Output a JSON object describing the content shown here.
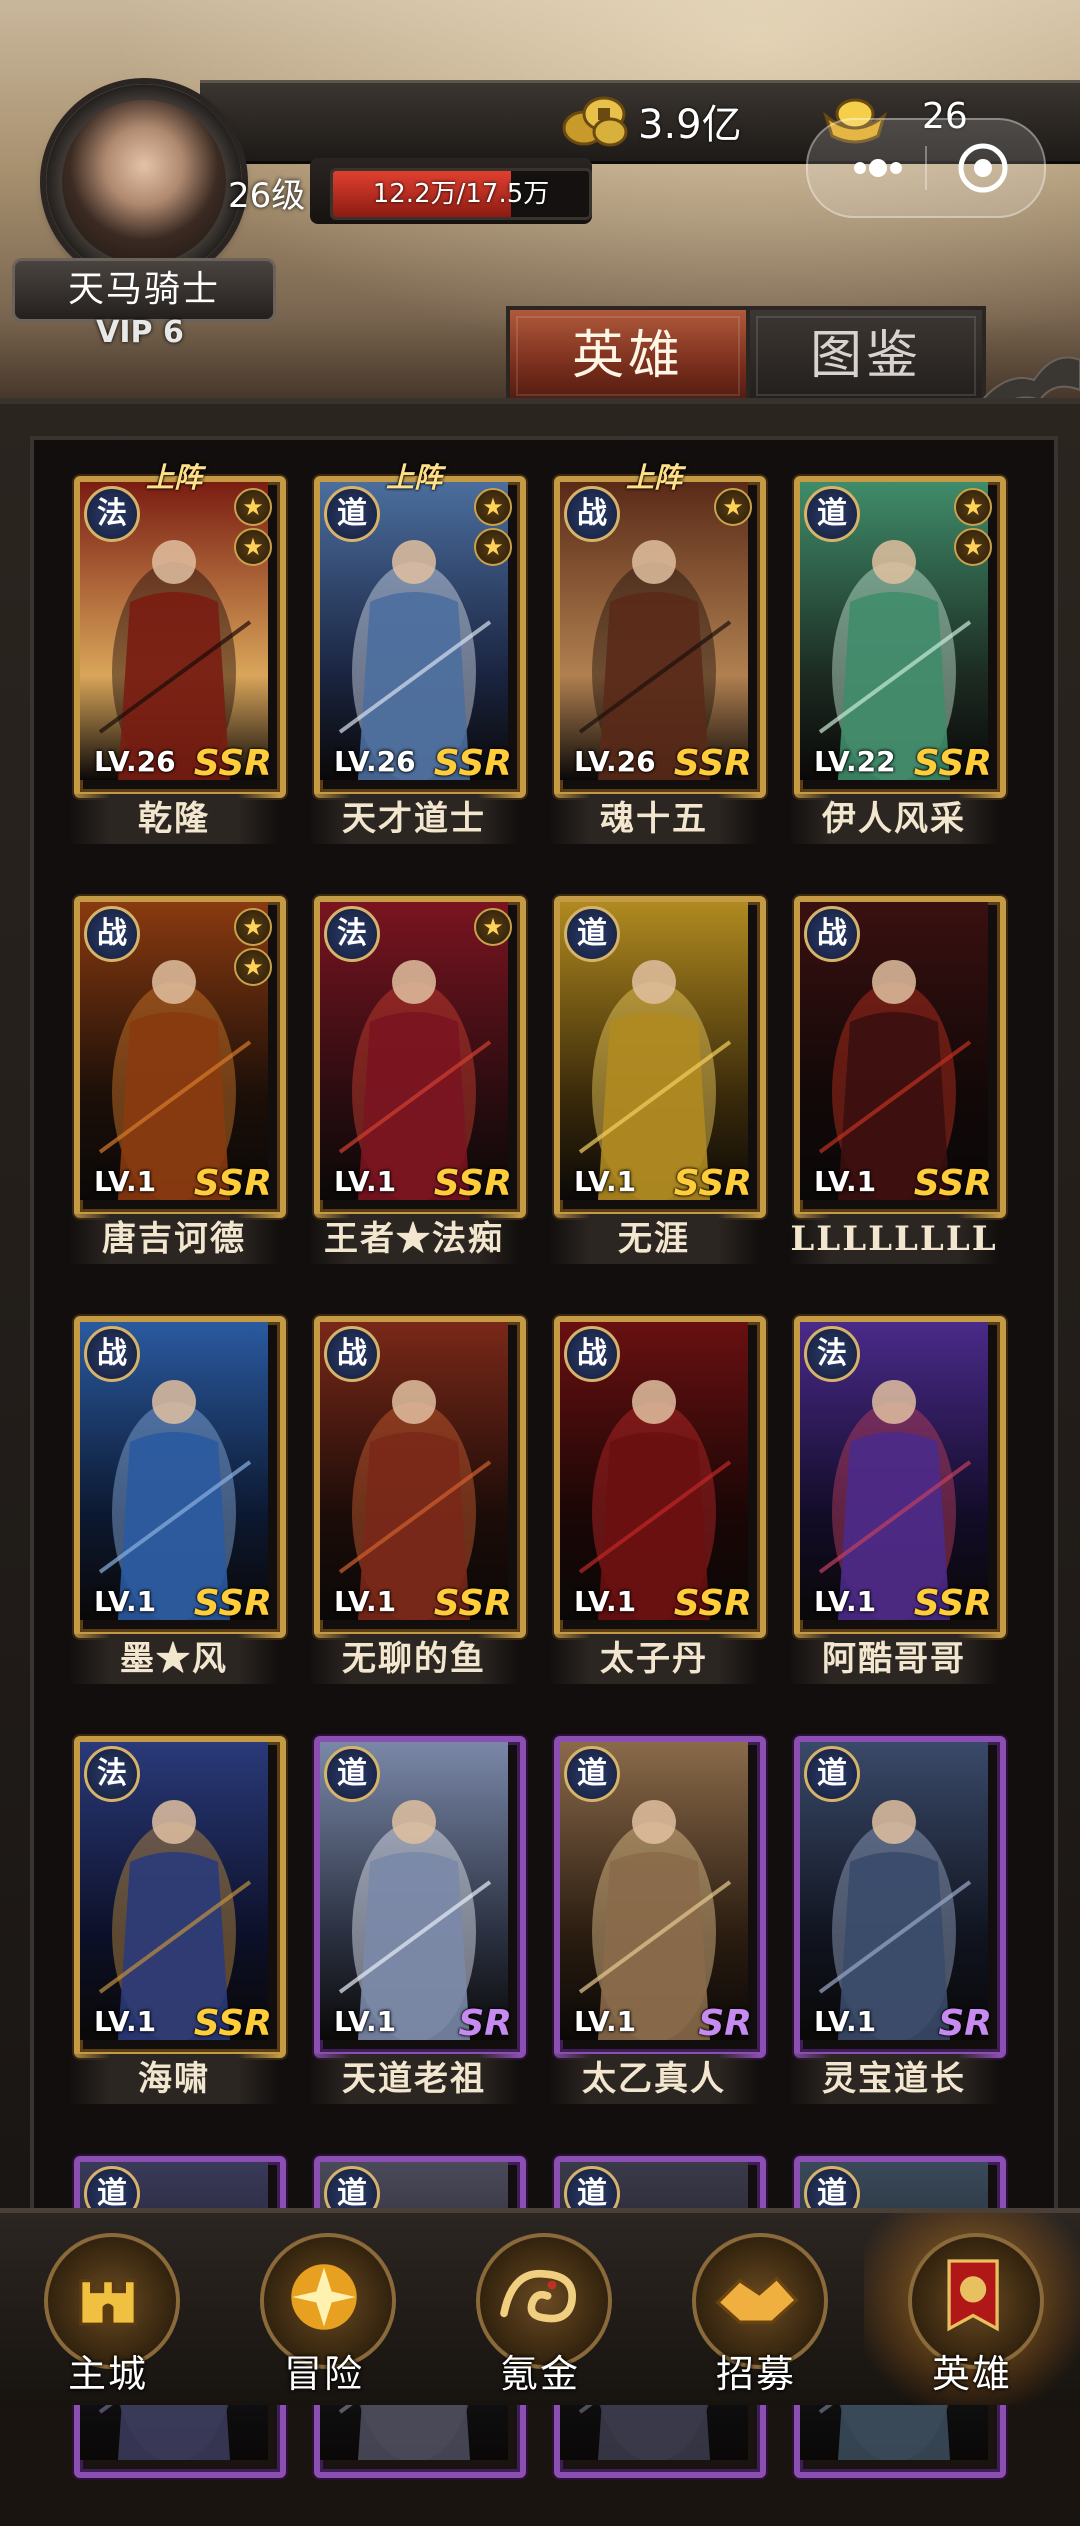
{
  "header": {
    "player_name": "天马骑士",
    "vip": "VIP 6",
    "level": "26级",
    "exp_text": "12.2万/17.5万",
    "exp_fraction": 0.697,
    "gold": "3.9亿",
    "ingots": "26"
  },
  "tabs": {
    "heroes": "英雄",
    "codex": "图鉴"
  },
  "deploy_label": "上阵",
  "heroes": [
    {
      "name": "乾隆",
      "class": "法",
      "level": "LV.26",
      "rarity": "SSR",
      "deployed": true,
      "stars": 2
    },
    {
      "name": "天才道士",
      "class": "道",
      "level": "LV.26",
      "rarity": "SSR",
      "deployed": true,
      "stars": 2
    },
    {
      "name": "魂十五",
      "class": "战",
      "level": "LV.26",
      "rarity": "SSR",
      "deployed": true,
      "stars": 1
    },
    {
      "name": "伊人风采",
      "class": "道",
      "level": "LV.22",
      "rarity": "SSR",
      "deployed": false,
      "stars": 2
    },
    {
      "name": "唐吉诃德",
      "class": "战",
      "level": "LV.1",
      "rarity": "SSR",
      "deployed": false,
      "stars": 2
    },
    {
      "name": "王者★法痴",
      "class": "法",
      "level": "LV.1",
      "rarity": "SSR",
      "deployed": false,
      "stars": 1
    },
    {
      "name": "无涯",
      "class": "道",
      "level": "LV.1",
      "rarity": "SSR",
      "deployed": false,
      "stars": 0
    },
    {
      "name": "LLLLLLLL",
      "class": "战",
      "level": "LV.1",
      "rarity": "SSR",
      "deployed": false,
      "stars": 0
    },
    {
      "name": "墨★风",
      "class": "战",
      "level": "LV.1",
      "rarity": "SSR",
      "deployed": false,
      "stars": 0
    },
    {
      "name": "无聊的鱼",
      "class": "战",
      "level": "LV.1",
      "rarity": "SSR",
      "deployed": false,
      "stars": 0
    },
    {
      "name": "太子丹",
      "class": "战",
      "level": "LV.1",
      "rarity": "SSR",
      "deployed": false,
      "stars": 0
    },
    {
      "name": "阿酷哥哥",
      "class": "法",
      "level": "LV.1",
      "rarity": "SSR",
      "deployed": false,
      "stars": 0
    },
    {
      "name": "海啸",
      "class": "法",
      "level": "LV.1",
      "rarity": "SSR",
      "deployed": false,
      "stars": 0
    },
    {
      "name": "天道老祖",
      "class": "道",
      "level": "LV.1",
      "rarity": "SR",
      "deployed": false,
      "stars": 0
    },
    {
      "name": "太乙真人",
      "class": "道",
      "level": "LV.1",
      "rarity": "SR",
      "deployed": false,
      "stars": 0
    },
    {
      "name": "灵宝道长",
      "class": "道",
      "level": "LV.1",
      "rarity": "SR",
      "deployed": false,
      "stars": 0
    },
    {
      "name": "",
      "class": "道",
      "level": "",
      "rarity": "SR",
      "deployed": false,
      "stars": 0
    },
    {
      "name": "",
      "class": "道",
      "level": "",
      "rarity": "SR",
      "deployed": false,
      "stars": 0
    },
    {
      "name": "",
      "class": "道",
      "level": "",
      "rarity": "SR",
      "deployed": false,
      "stars": 0
    },
    {
      "name": "",
      "class": "道",
      "level": "",
      "rarity": "SR",
      "deployed": false,
      "stars": 0
    }
  ],
  "nav": [
    {
      "label": "主城",
      "icon": "castle-icon"
    },
    {
      "label": "冒险",
      "icon": "adventure-icon"
    },
    {
      "label": "氪金",
      "icon": "dragon-icon"
    },
    {
      "label": "招募",
      "icon": "handshake-icon"
    },
    {
      "label": "英雄",
      "icon": "banner-icon",
      "active": true
    }
  ],
  "colors": {
    "gold_frame": "#c49a45",
    "purple_frame": "#8a4fb0",
    "ssr": "#ffcc3a",
    "sr": "#c78af0"
  }
}
